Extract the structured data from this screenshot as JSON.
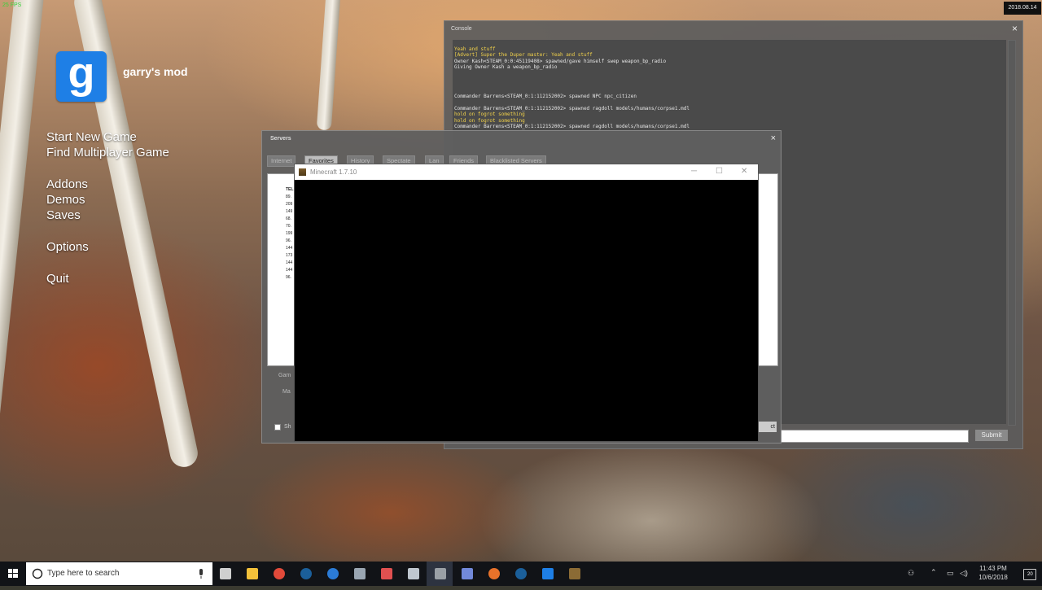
{
  "overlay": {
    "fps": "25 FPS",
    "date_stamp": "2018.08.14"
  },
  "gmod": {
    "logo_letter": "g",
    "title": "garry's mod"
  },
  "main_menu": {
    "start_new_game": "Start New Game",
    "find_multiplayer_game": "Find Multiplayer Game",
    "addons": "Addons",
    "demos": "Demos",
    "saves": "Saves",
    "options": "Options",
    "quit": "Quit"
  },
  "console": {
    "title": "Console",
    "close": "×",
    "submit_label": "Submit",
    "input_value": "",
    "lines": [
      {
        "text": "Yeah and stuff",
        "color": "#f2d24a"
      },
      {
        "text": "[Advert] Super the Duper master: Yeah and stuff",
        "color": "#f2d24a"
      },
      {
        "text": "Owner Kash<STEAM_0:0:45119408> spawned/gave himself swep weapon_bp_radio",
        "color": "#e6e6e6"
      },
      {
        "text": "Giving Owner Kash a weapon_bp_radio",
        "color": "#e6e6e6"
      },
      {
        "text": "",
        "color": "#e6e6e6"
      },
      {
        "text": "",
        "color": "#d22"
      },
      {
        "text": "",
        "color": "#d22"
      },
      {
        "text": "",
        "color": "#d22"
      },
      {
        "text": "Commander Barrens<STEAM_0:1:112152002> spawned NPC npc_citizen",
        "color": "#e6e6e6"
      },
      {
        "text": "",
        "color": "#d22"
      },
      {
        "text": "Commander Barrens<STEAM_0:1:112152002> spawned ragdoll models/humans/corpse1.mdl",
        "color": "#e6e6e6"
      },
      {
        "text": "hold on fogrot something",
        "color": "#f2d24a"
      },
      {
        "text": "hold on fogrot something",
        "color": "#f2d24a"
      },
      {
        "text": "Commander Barrens<STEAM_0:1:112152002> spawned ragdoll models/humans/corpse1.mdl",
        "color": "#e6e6e6"
      }
    ]
  },
  "servers": {
    "title": "Servers",
    "close": "×",
    "tabs": [
      "Internet",
      "Favorites",
      "History",
      "Spectate",
      "Lan",
      "Friends",
      "Blacklisted Servers"
    ],
    "active_tab": "Favorites",
    "first_row_prefix": "TEL",
    "row_prefixes": [
      "89.",
      "209",
      "149",
      "68.",
      "70.",
      "199",
      "96.",
      "144",
      "173",
      "144",
      "144",
      "96."
    ],
    "label_game": "Gam",
    "label_map": "Ma",
    "checkbox_label": "Sh",
    "connect_label": "ct"
  },
  "minecraft": {
    "title": "Minecraft 1.7.10",
    "minimize": "─",
    "maximize": "☐",
    "close": "✕"
  },
  "taskbar": {
    "search_placeholder": "Type here to search",
    "clock_time": "11:43 PM",
    "clock_date": "10/6/2018",
    "notification_count": "20",
    "pinned_icons": [
      {
        "name": "task-view-icon",
        "color": "#cfcfcf"
      },
      {
        "name": "file-explorer-icon",
        "color": "#f3c13a"
      },
      {
        "name": "chrome-icon",
        "color": "#e24a3a"
      },
      {
        "name": "steam-icon",
        "color": "#1b5f9a"
      },
      {
        "name": "browser-icon",
        "color": "#2b7bd6"
      },
      {
        "name": "app-icon",
        "color": "#9aa6b2"
      },
      {
        "name": "paint-icon",
        "color": "#e05050"
      },
      {
        "name": "photos-icon",
        "color": "#bfc7cf"
      },
      {
        "name": "gmod-hl-icon",
        "color": "#9aa0a6"
      },
      {
        "name": "discord-icon",
        "color": "#7289da"
      },
      {
        "name": "firefox-icon",
        "color": "#e8722a"
      },
      {
        "name": "steam2-icon",
        "color": "#1b5f9a"
      },
      {
        "name": "gmod-icon",
        "color": "#1e7fe6"
      },
      {
        "name": "minecraft-icon",
        "color": "#8b6b35"
      }
    ]
  }
}
